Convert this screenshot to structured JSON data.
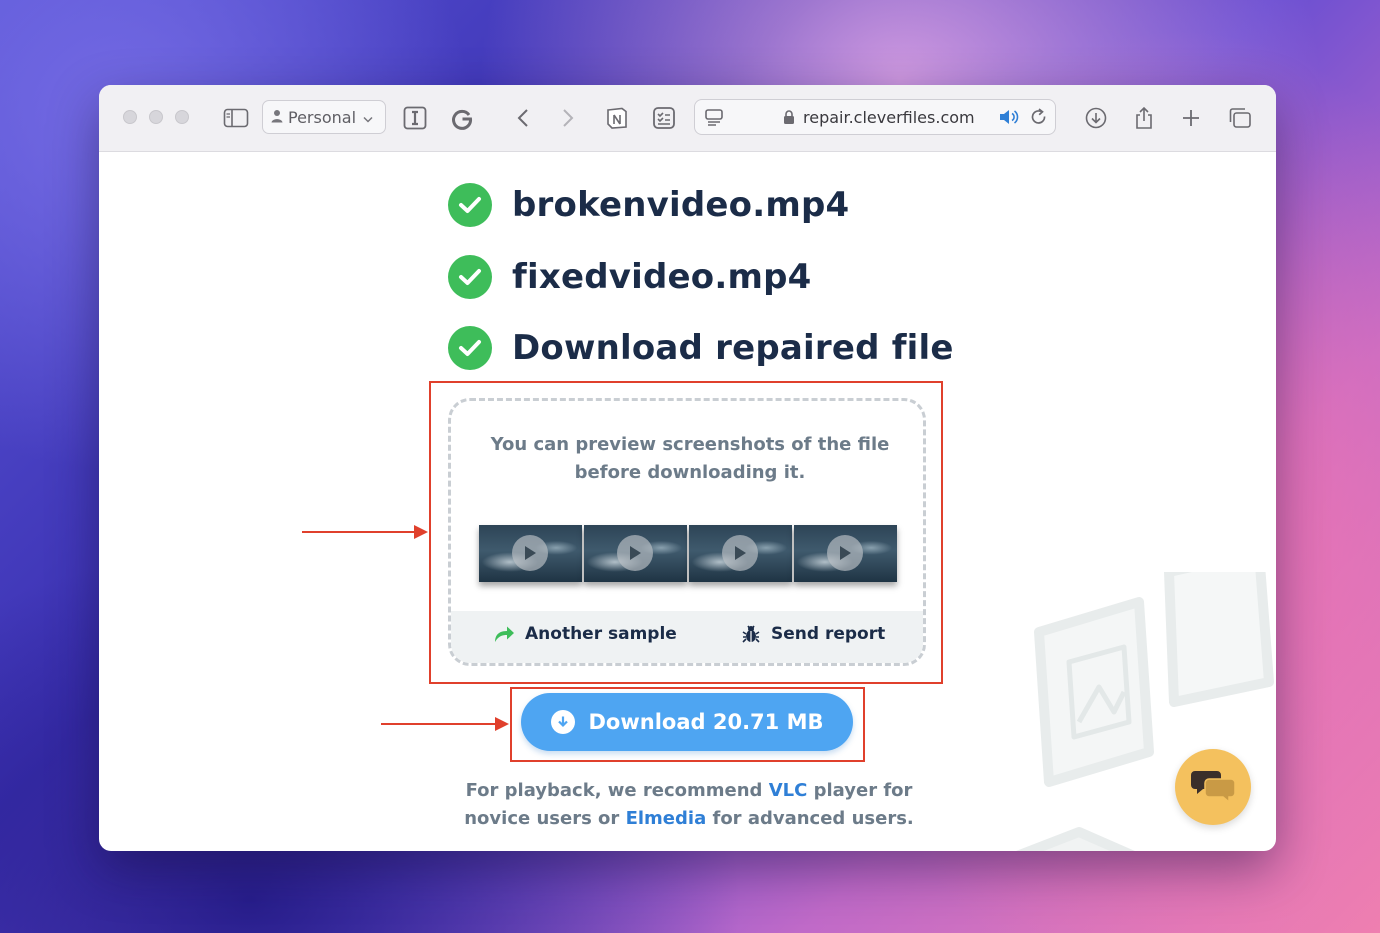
{
  "browser": {
    "profile_label": "Personal",
    "url": "repair.cleverfiles.com"
  },
  "steps": [
    {
      "label": "brokenvideo.mp4"
    },
    {
      "label": "fixedvideo.mp4"
    },
    {
      "label": "Download repaired file"
    }
  ],
  "preview": {
    "message": "You can preview screenshots of the file before downloading it.",
    "thumbnails": [
      "video-frame-1",
      "video-frame-2",
      "video-frame-3",
      "video-frame-4"
    ],
    "another_sample": "Another sample",
    "send_report": "Send report"
  },
  "download": {
    "label": "Download 20.71 MB"
  },
  "note": {
    "part1": "For playback, we recommend ",
    "vlc": "VLC",
    "part2": " player for novice users or ",
    "elmedia": "Elmedia",
    "part3": " for advanced users."
  },
  "colors": {
    "accent_green": "#3ebd5a",
    "download_blue": "#4ea5f2",
    "annotation_red": "#e0402c",
    "heading_navy": "#1b2c48",
    "chat_yellow": "#f4c15e"
  },
  "icons": [
    "sidebar-icon",
    "person-icon",
    "reader-icon",
    "grammarly-icon",
    "back-icon",
    "forward-icon",
    "notion-icon",
    "clipboard-icon",
    "page-menu-icon",
    "lock-icon",
    "speaker-icon",
    "reload-icon",
    "downloads-icon",
    "share-icon",
    "new-tab-icon",
    "tabs-overview-icon",
    "check-icon",
    "play-icon",
    "redo-arrow-icon",
    "bug-icon",
    "download-arrow-icon",
    "chat-icon"
  ]
}
